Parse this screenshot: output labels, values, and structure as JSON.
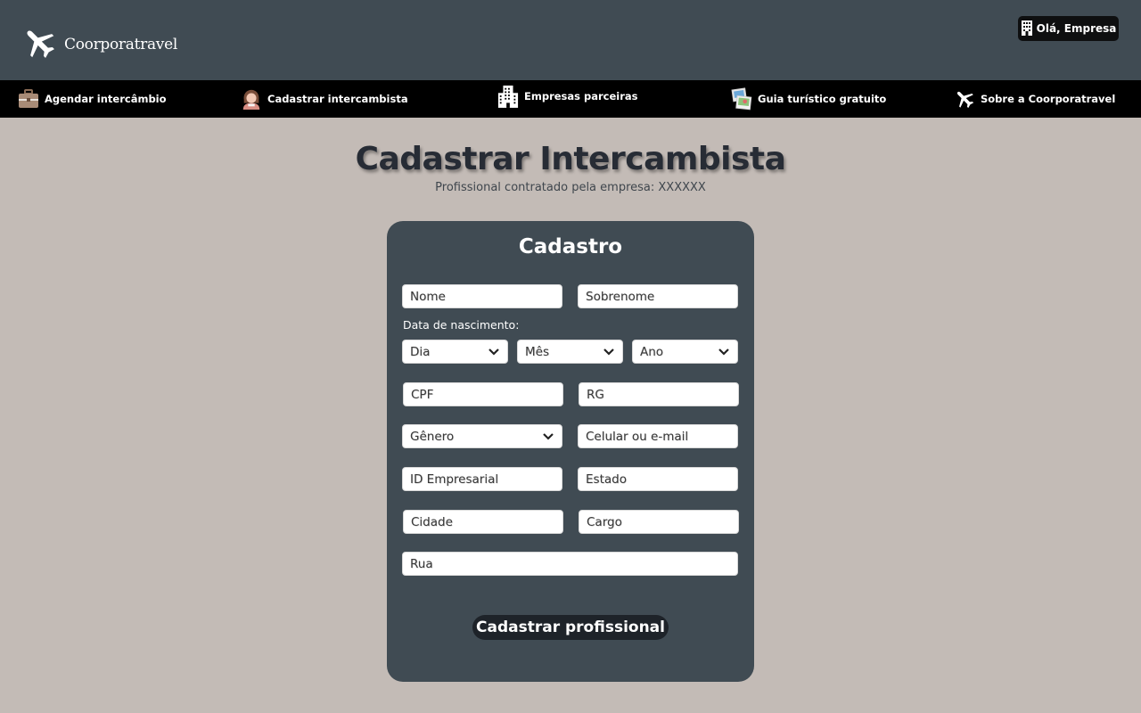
{
  "header": {
    "brand_name": "Coorporatravel",
    "brand_icon": "airplane-icon",
    "user_greeting": "Olá, Empresa",
    "user_icon": "building-icon"
  },
  "nav": {
    "items": [
      {
        "label": "Agendar intercâmbio",
        "icon": "briefcase-icon"
      },
      {
        "label": "Cadastrar intercambista",
        "icon": "person-avatar-icon"
      },
      {
        "label": "Empresas parceiras",
        "icon": "building-icon"
      },
      {
        "label": "Guia turístico gratuito",
        "icon": "photos-icon"
      },
      {
        "label": "Sobre a Coorporatravel",
        "icon": "airplane-icon"
      }
    ]
  },
  "page": {
    "title": "Cadastrar Intercambista",
    "subtitle": "Profissional contratado pela empresa: XXXXXX"
  },
  "form": {
    "title": "Cadastro",
    "nome": "Nome",
    "sobrenome": "Sobrenome",
    "dob_label": "Data de nascimento:",
    "dia": "Dia",
    "mes": "Mês",
    "ano": "Ano",
    "cpf": "CPF",
    "rg": "RG",
    "genero": "Gênero",
    "contato": "Celular ou e-mail",
    "id_empresarial": "ID Empresarial",
    "estado": "Estado",
    "cidade": "Cidade",
    "cargo": "Cargo",
    "rua": "Rua",
    "submit_label": "Cadastrar profissional"
  },
  "colors": {
    "header_bg": "#404b53",
    "nav_bg": "#000000",
    "page_bg": "#c3bbb6",
    "card_bg": "#404b53",
    "button_bg": "#1e2329"
  }
}
